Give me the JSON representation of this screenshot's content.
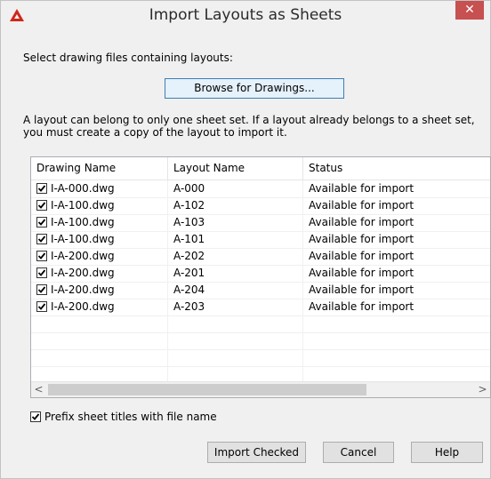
{
  "window": {
    "title": "Import Layouts as Sheets",
    "close_glyph": "✕"
  },
  "select_label": "Select drawing files containing layouts:",
  "browse_button": "Browse for Drawings...",
  "note": "A layout can belong to only one sheet set. If a layout already belongs to a sheet set, you must create a copy of the layout to import it.",
  "table": {
    "columns": [
      "Drawing Name",
      "Layout Name",
      "Status"
    ],
    "rows": [
      {
        "checked": true,
        "drawing": "I-A-000.dwg",
        "layout": "A-000",
        "status": "Available for import"
      },
      {
        "checked": true,
        "drawing": "I-A-100.dwg",
        "layout": "A-102",
        "status": "Available for import"
      },
      {
        "checked": true,
        "drawing": "I-A-100.dwg",
        "layout": "A-103",
        "status": "Available for import"
      },
      {
        "checked": true,
        "drawing": "I-A-100.dwg",
        "layout": "A-101",
        "status": "Available for import"
      },
      {
        "checked": true,
        "drawing": "I-A-200.dwg",
        "layout": "A-202",
        "status": "Available for import"
      },
      {
        "checked": true,
        "drawing": "I-A-200.dwg",
        "layout": "A-201",
        "status": "Available for import"
      },
      {
        "checked": true,
        "drawing": "I-A-200.dwg",
        "layout": "A-204",
        "status": "Available for import"
      },
      {
        "checked": true,
        "drawing": "I-A-200.dwg",
        "layout": "A-203",
        "status": "Available for import"
      }
    ],
    "scroll_left": "<",
    "scroll_right": ">"
  },
  "prefix_option": {
    "checked": true,
    "label": "Prefix sheet titles with file name"
  },
  "buttons": {
    "import_checked": "Import Checked",
    "cancel": "Cancel",
    "help": "Help"
  },
  "colors": {
    "brand_red": "#d0261a",
    "close_red": "#c75050"
  }
}
